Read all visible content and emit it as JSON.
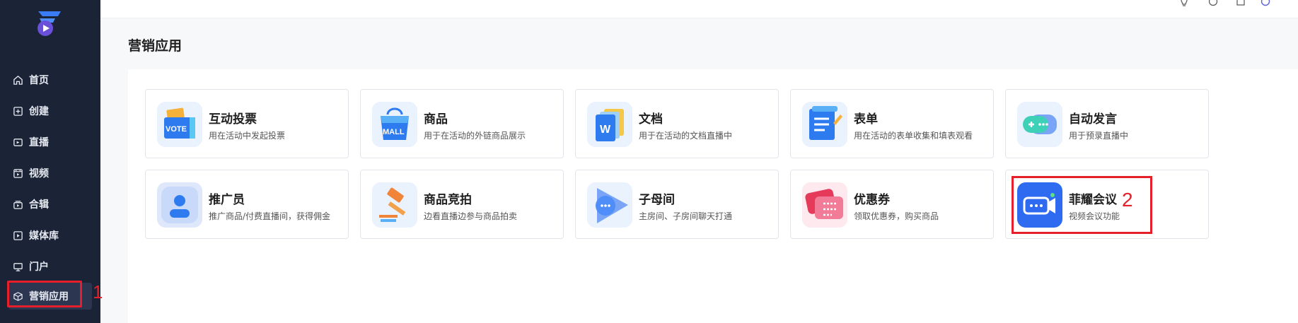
{
  "page": {
    "title": "营销应用"
  },
  "sidebar": {
    "items": [
      {
        "label": "首页",
        "icon": "home-icon"
      },
      {
        "label": "创建",
        "icon": "plus-square-icon"
      },
      {
        "label": "直播",
        "icon": "live-icon"
      },
      {
        "label": "视频",
        "icon": "video-icon"
      },
      {
        "label": "合辑",
        "icon": "collection-icon"
      },
      {
        "label": "媒体库",
        "icon": "media-library-icon"
      },
      {
        "label": "门户",
        "icon": "monitor-icon"
      },
      {
        "label": "营销应用",
        "icon": "cube-icon",
        "active": true
      }
    ]
  },
  "annotations": {
    "first": "1",
    "second": "2",
    "color": "#e5202a"
  },
  "cards": [
    {
      "title": "互动投票",
      "desc": "用在活动中发起投票",
      "thumb_text": "VOTE",
      "icon": "vote-icon"
    },
    {
      "title": "商品",
      "desc": "用于在活动的外链商品展示",
      "thumb_text": "MALL",
      "icon": "mall-bag-icon"
    },
    {
      "title": "文档",
      "desc": "用于在活动的文档直播中",
      "thumb_text": "W",
      "icon": "document-icon"
    },
    {
      "title": "表单",
      "desc": "用在活动的表单收集和填表观看",
      "icon": "form-icon"
    },
    {
      "title": "自动发言",
      "desc": "用于预录直播中",
      "icon": "auto-chat-icon"
    },
    {
      "title": "推广员",
      "desc": "推广商品/付费直播间，获得佣金",
      "icon": "promoter-icon"
    },
    {
      "title": "商品竞拍",
      "desc": "边看直播边参与商品拍卖",
      "icon": "auction-hammer-icon"
    },
    {
      "title": "子母间",
      "desc": "主房间、子房间聊天打通",
      "icon": "sub-room-icon"
    },
    {
      "title": "优惠券",
      "desc": "领取优惠券，购买商品",
      "icon": "coupon-icon"
    },
    {
      "title": "菲耀会议",
      "desc": "视频会议功能",
      "icon": "video-meeting-icon"
    }
  ],
  "colors": {
    "sidebar_bg": "#1b2337",
    "accent": "#2f6bf0",
    "annotation": "#e5202a"
  }
}
